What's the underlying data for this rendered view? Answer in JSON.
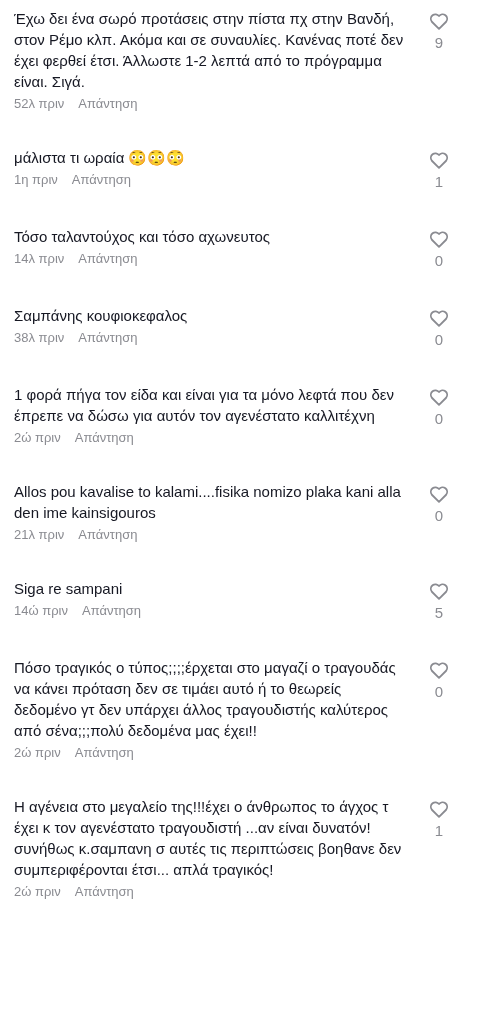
{
  "comments": [
    {
      "text": "Έχω δει ένα σωρό προτάσεις στην πίστα πχ στην Βανδή, στον Ρέμο κλπ. Ακόμα και σε συναυλίες. Κανένας ποτέ δεν έχει φερθεί έτσι. Άλλωστε 1-2 λεπτά από το πρόγραμμα είναι. Σιγά.",
      "time": "52λ πριν",
      "reply": "Απάντηση",
      "likes": "9"
    },
    {
      "text": "μάλιστα τι ωραία 😳😳😳",
      "time": "1η πριν",
      "reply": "Απάντηση",
      "likes": "1"
    },
    {
      "text": "Τόσο ταλαντούχος και τόσο αχωνευτος",
      "time": "14λ πριν",
      "reply": "Απάντηση",
      "likes": "0"
    },
    {
      "text": "Σαμπάνης κουφιοκεφαλος",
      "time": "38λ πριν",
      "reply": "Απάντηση",
      "likes": "0"
    },
    {
      "text": "1 φορά πήγα τον είδα και είναι για τα μόνο λεφτά που δεν έπρεπε να δώσω για αυτόν τον αγενέστατο καλλιτέχνη",
      "time": "2ώ πριν",
      "reply": "Απάντηση",
      "likes": "0"
    },
    {
      "text": "Allos pou kavalise to kalami....fisika nomizo plaka kani alla den ime kainsigouros",
      "time": "21λ πριν",
      "reply": "Απάντηση",
      "likes": "0"
    },
    {
      "text": "Siga re sampani",
      "time": "14ώ πριν",
      "reply": "Απάντηση",
      "likes": "5"
    },
    {
      "text": "Πόσο τραγικός ο τύπος;;;;έρχεται στο μαγαζί ο τραγουδάς να κάνει πρόταση δεν σε τιμάει αυτό ή το θεωρείς δεδομένο γτ δεν υπάρχει άλλος τραγουδιστής καλύτερος από σένα;;;πολύ δεδομένα μας έχει!!",
      "time": "2ώ πριν",
      "reply": "Απάντηση",
      "likes": "0"
    },
    {
      "text": "Η αγένεια στο μεγαλείο της!!!έχει ο άνθρωπος το άγχος τ έχει κ τον αγενέστατο τραγουδιστή ...αν είναι δυνατόν!συνήθως κ.σαμπανη σ αυτές τις περιπτώσεις βοηθανε δεν συμπεριφέρονται έτσι... απλά τραγικός!",
      "time": "2ώ πριν",
      "reply": "Απάντηση",
      "likes": "1"
    }
  ]
}
